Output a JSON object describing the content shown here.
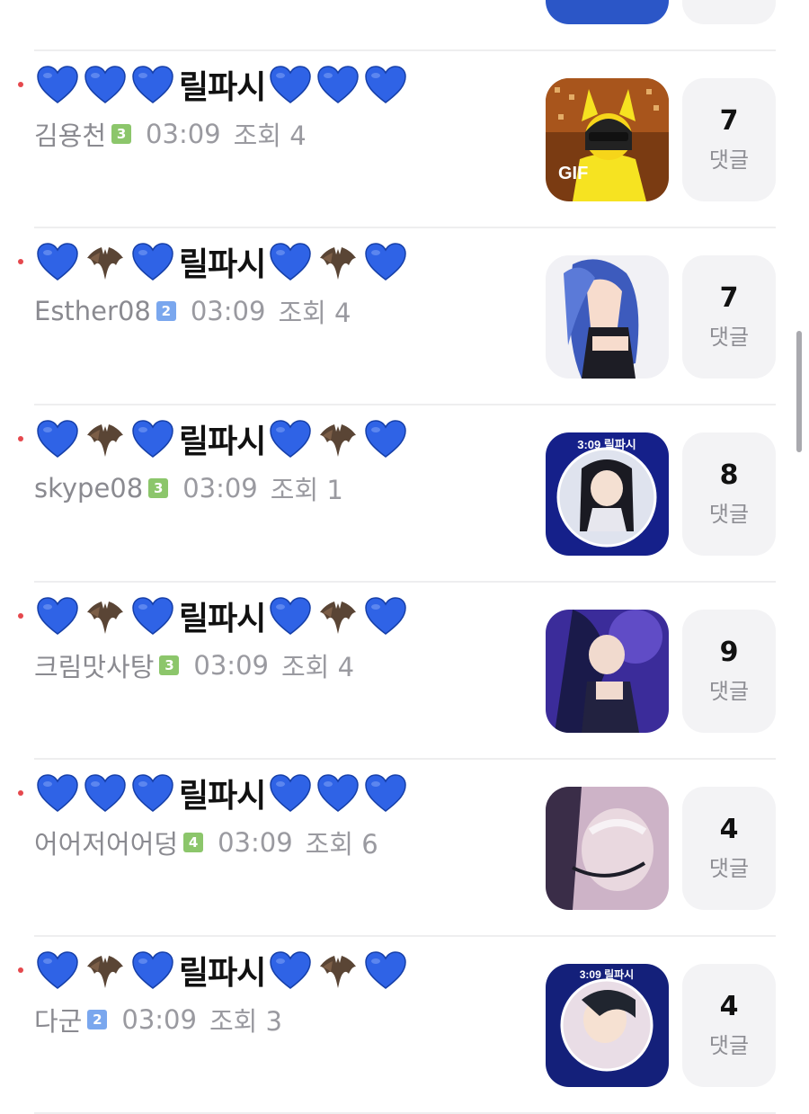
{
  "comment_label": "댓글",
  "posts": [
    {
      "title_word": "릴파시",
      "emojis": [
        "blue-heart-emoji",
        "blue-heart-emoji",
        "blue-heart-emoji",
        "blue-heart-emoji",
        "blue-heart-emoji",
        "blue-heart-emoji"
      ],
      "author": "김용천",
      "level": "3",
      "level_color": "#8cc66b",
      "time": "03:09",
      "views": "조회 4",
      "comments": "7",
      "thumb_badge": "GIF"
    },
    {
      "title_word": "릴파시",
      "emojis": [
        "blue-heart-emoji",
        "bat-emoji",
        "blue-heart-emoji",
        "blue-heart-emoji",
        "bat-emoji",
        "blue-heart-emoji"
      ],
      "author": "Esther08",
      "level": "2",
      "level_color": "#7aa7ee",
      "time": "03:09",
      "views": "조회 4",
      "comments": "7"
    },
    {
      "title_word": "릴파시",
      "emojis": [
        "blue-heart-emoji",
        "bat-emoji",
        "blue-heart-emoji",
        "blue-heart-emoji",
        "bat-emoji",
        "blue-heart-emoji"
      ],
      "author": "skype08",
      "level": "3",
      "level_color": "#8cc66b",
      "time": "03:09",
      "views": "조회 1",
      "comments": "8",
      "thumb_caption": "3:09 릴파시"
    },
    {
      "title_word": "릴파시",
      "emojis": [
        "blue-heart-emoji",
        "bat-emoji",
        "blue-heart-emoji",
        "blue-heart-emoji",
        "bat-emoji",
        "blue-heart-emoji"
      ],
      "author": "크림맛사탕",
      "level": "3",
      "level_color": "#8cc66b",
      "time": "03:09",
      "views": "조회 4",
      "comments": "9"
    },
    {
      "title_word": "릴파시",
      "emojis": [
        "blue-heart-emoji",
        "blue-heart-emoji",
        "blue-heart-emoji",
        "blue-heart-emoji",
        "blue-heart-emoji",
        "blue-heart-emoji"
      ],
      "author": "어어저어어덩",
      "level": "4",
      "level_color": "#8cc66b",
      "time": "03:09",
      "views": "조회 6",
      "comments": "4"
    },
    {
      "title_word": "릴파시",
      "emojis": [
        "blue-heart-emoji",
        "bat-emoji",
        "blue-heart-emoji",
        "blue-heart-emoji",
        "bat-emoji",
        "blue-heart-emoji"
      ],
      "author": "다군",
      "level": "2",
      "level_color": "#7aa7ee",
      "time": "03:09",
      "views": "조회 3",
      "comments": "4",
      "thumb_caption": "3:09 릴파시"
    }
  ],
  "colors": {
    "accent_dot": "#e5484d",
    "heart": "#2f63e6",
    "bat": "#5a4535"
  }
}
